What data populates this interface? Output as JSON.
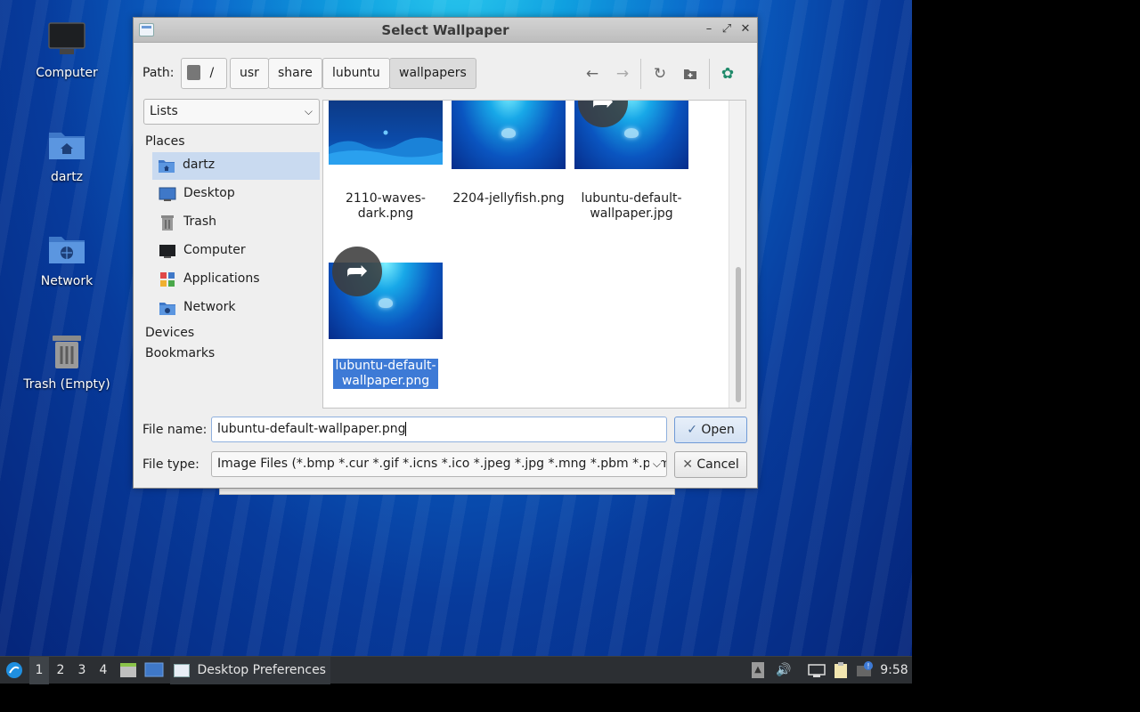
{
  "desktop": {
    "icons": [
      {
        "label": "Computer"
      },
      {
        "label": "dartz"
      },
      {
        "label": "Network"
      },
      {
        "label": "Trash (Empty)"
      }
    ]
  },
  "dialog": {
    "title": "Select Wallpaper",
    "path_label": "Path:",
    "path_segments": [
      "/",
      "usr",
      "share",
      "lubuntu",
      "wallpapers"
    ],
    "view_mode": "Lists",
    "sidebar": {
      "places_label": "Places",
      "places": [
        "dartz",
        "Desktop",
        "Trash",
        "Computer",
        "Applications",
        "Network"
      ],
      "devices_label": "Devices",
      "bookmarks_label": "Bookmarks"
    },
    "files": [
      {
        "name": "2110-waves-dark.png",
        "line1": "2110-waves-",
        "line2": "dark.png"
      },
      {
        "name": "2204-jellyfish.png",
        "line1": "2204-jellyfish.png",
        "line2": ""
      },
      {
        "name": "lubuntu-default-wallpaper.jpg",
        "line1": "lubuntu-default-",
        "line2": "wallpaper.jpg"
      },
      {
        "name": "lubuntu-default-wallpaper.png",
        "line1": "lubuntu-default-",
        "line2": "wallpaper.png"
      }
    ],
    "file_name_label": "File name:",
    "file_name_value": "lubuntu-default-wallpaper.png",
    "file_type_label": "File type:",
    "file_type_value": "Image Files (*.bmp *.cur *.gif *.icns *.ico *.jpeg *.jpg *.mng *.pbm *.pgm",
    "open_label": "Open",
    "cancel_label": "Cancel"
  },
  "taskbar": {
    "workspaces": [
      "1",
      "2",
      "3",
      "4"
    ],
    "active_workspace": "1",
    "task_label": "Desktop Preferences",
    "clock": "9:58"
  },
  "colors": {
    "selection": "#3d7ad6",
    "place_selected": "#c9daf0",
    "taskbar": "#2c2f33"
  }
}
